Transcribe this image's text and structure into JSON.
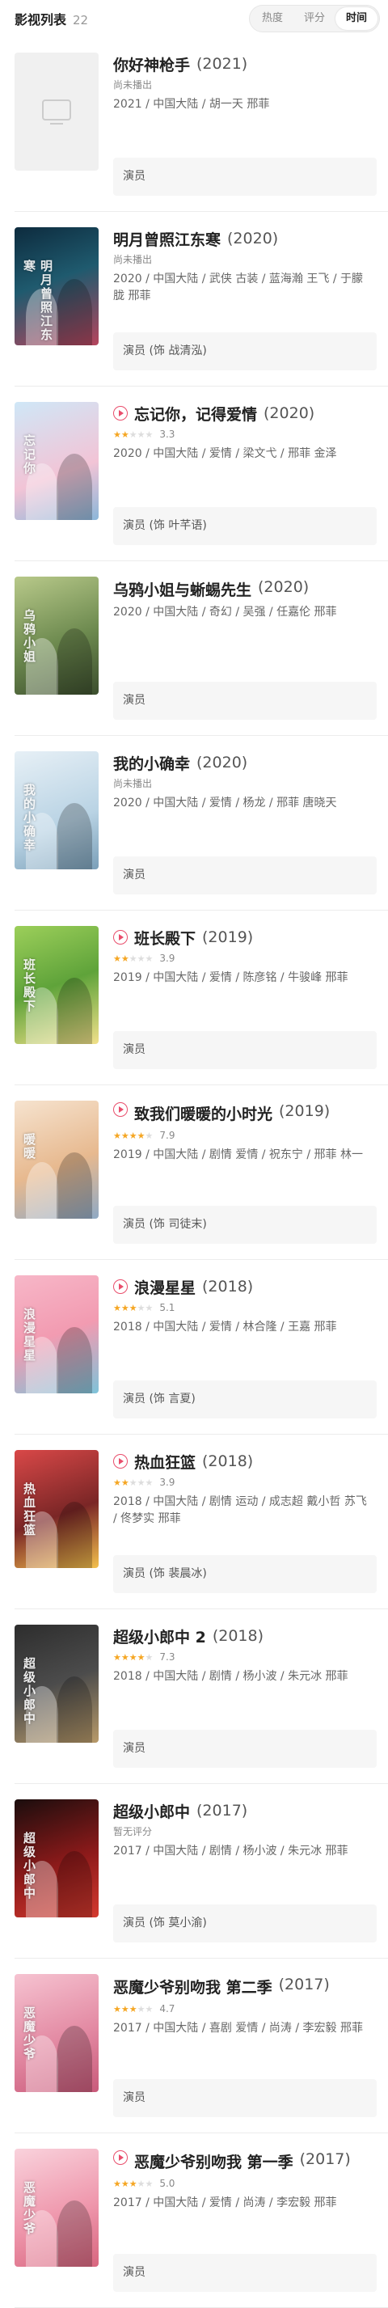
{
  "header": {
    "title": "影视列表",
    "count": "22",
    "sort_options": [
      "热度",
      "评分",
      "时间"
    ],
    "active_sort": "时间"
  },
  "items": [
    {
      "title": "你好神枪手",
      "year": "(2021)",
      "playable": false,
      "rating_text": "尚未播出",
      "stars": 0,
      "score": "",
      "meta": "2021 / 中国大陆 / 胡一天 邢菲",
      "role": "演员",
      "poster": "placeholder"
    },
    {
      "title": "明月曾照江东寒",
      "year": "(2020)",
      "playable": false,
      "rating_text": "尚未播出",
      "stars": 0,
      "score": "",
      "meta": "2020 / 中国大陆 / 武侠 古装 / 蓝海瀚 王飞 / 于朦胧 邢菲",
      "role": "演员 (饰 战清泓)",
      "poster": "明月曾照江东寒"
    },
    {
      "title": "忘记你，记得爱情",
      "year": "(2020)",
      "playable": true,
      "rating_text": "",
      "stars": 1.5,
      "score": "3.3",
      "meta": "2020 / 中国大陆 / 爱情 / 梁文弋 / 邢菲 金泽",
      "role": "演员 (饰 叶芊语)",
      "poster": "忘记你"
    },
    {
      "title": "乌鸦小姐与蜥蜴先生",
      "year": "(2020)",
      "playable": false,
      "rating_text": "",
      "stars": 0,
      "score": "",
      "meta": "2020 / 中国大陆 / 奇幻 / 吴强 / 任嘉伦 邢菲",
      "role": "演员",
      "poster": "乌鸦小姐"
    },
    {
      "title": "我的小确幸",
      "year": "(2020)",
      "playable": false,
      "rating_text": "尚未播出",
      "stars": 0,
      "score": "",
      "meta": "2020 / 中国大陆 / 爱情 / 杨龙 / 邢菲 唐晓天",
      "role": "演员",
      "poster": "我的小确幸"
    },
    {
      "title": "班长殿下",
      "year": "(2019)",
      "playable": true,
      "rating_text": "",
      "stars": 2,
      "score": "3.9",
      "meta": "2019 / 中国大陆 / 爱情 / 陈彦铭 / 牛骏峰 邢菲",
      "role": "演员",
      "poster": "班长殿下"
    },
    {
      "title": "致我们暖暖的小时光",
      "year": "(2019)",
      "playable": true,
      "rating_text": "",
      "stars": 4,
      "score": "7.9",
      "meta": "2019 / 中国大陆 / 剧情 爱情 / 祝东宁 / 邢菲 林一",
      "role": "演员 (饰 司徒末)",
      "poster": "暖暖"
    },
    {
      "title": "浪漫星星",
      "year": "(2018)",
      "playable": true,
      "rating_text": "",
      "stars": 2.5,
      "score": "5.1",
      "meta": "2018 / 中国大陆 / 爱情 / 林合隆 / 王嘉 邢菲",
      "role": "演员 (饰 言夏)",
      "poster": "浪漫星星"
    },
    {
      "title": "热血狂篮",
      "year": "(2018)",
      "playable": true,
      "rating_text": "",
      "stars": 2,
      "score": "3.9",
      "meta": "2018 / 中国大陆 / 剧情 运动 / 成志超 戴小哲 苏飞 / 佟梦实 邢菲",
      "role": "演员 (饰 裴晨冰)",
      "poster": "热血狂篮"
    },
    {
      "title": "超级小郎中 2",
      "year": "(2018)",
      "playable": false,
      "rating_text": "",
      "stars": 3.5,
      "score": "7.3",
      "meta": "2018 / 中国大陆 / 剧情 / 杨小波 / 朱元冰 邢菲",
      "role": "演员",
      "poster": "超级小郎中"
    },
    {
      "title": "超级小郎中",
      "year": "(2017)",
      "playable": false,
      "rating_text": "暂无评分",
      "stars": 0,
      "score": "",
      "meta": "2017 / 中国大陆 / 剧情 / 杨小波 / 朱元冰 邢菲",
      "role": "演员 (饰 莫小渝)",
      "poster": "超级小郎中"
    },
    {
      "title": "恶魔少爷别吻我 第二季",
      "year": "(2017)",
      "playable": false,
      "rating_text": "",
      "stars": 2.5,
      "score": "4.7",
      "meta": "2017 / 中国大陆 / 喜剧 爱情 / 尚涛 / 李宏毅 邢菲",
      "role": "演员",
      "poster": "恶魔少爷"
    },
    {
      "title": "恶魔少爷别吻我 第一季",
      "year": "(2017)",
      "playable": true,
      "rating_text": "",
      "stars": 2.5,
      "score": "5.0",
      "meta": "2017 / 中国大陆 / 爱情 / 尚涛 / 李宏毅 邢菲",
      "role": "演员",
      "poster": "恶魔少爷"
    }
  ]
}
